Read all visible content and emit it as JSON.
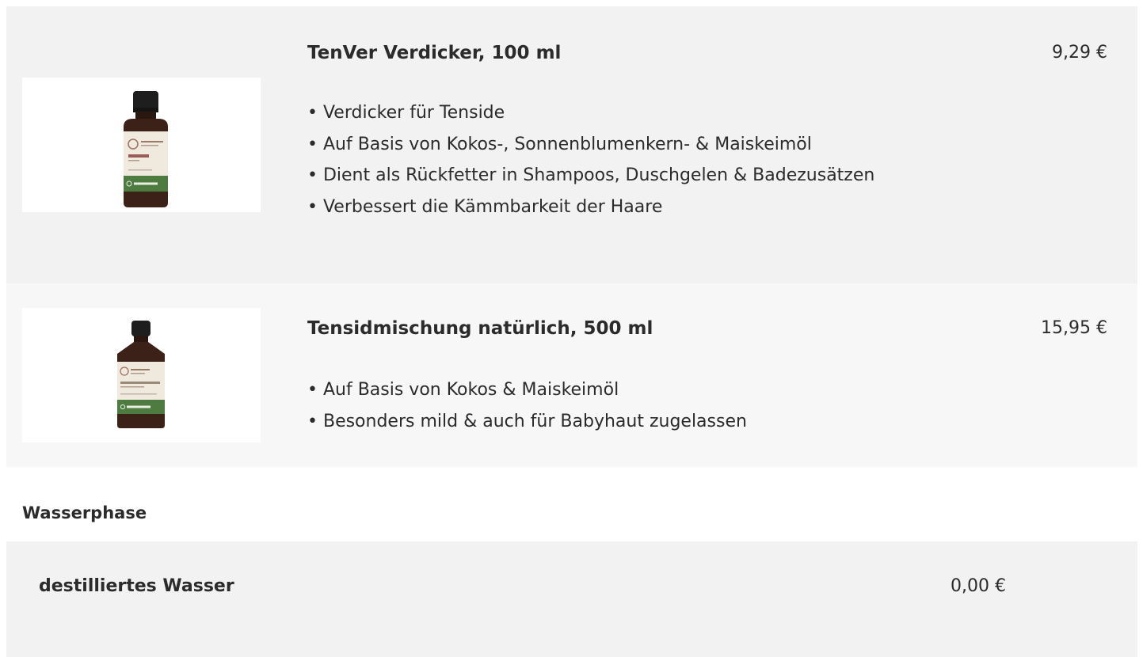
{
  "products": [
    {
      "title": "TenVer Verdicker, 100 ml",
      "price": "9,29 €",
      "image_alt": "TenVer Verdicker Flasche",
      "features": [
        "• Verdicker für Tenside",
        "• Auf Basis von Kokos-, Sonnenblumenkern- & Maiskeimöl",
        "• Dient als Rückfetter in Shampoos, Duschgelen & Badezusätzen",
        "• Verbessert die Kämmbarkeit der Haare"
      ]
    },
    {
      "title": "Tensidmischung natürlich, 500 ml",
      "price": "15,95 €",
      "image_alt": "Tensidmischung natürlich Flasche",
      "features": [
        "• Auf Basis von Kokos & Maiskeimöl",
        "• Besonders mild & auch für Babyhaut zugelassen"
      ]
    }
  ],
  "section": {
    "heading": "Wasserphase"
  },
  "ingredient": {
    "name": "destilliertes Wasser",
    "price": "0,00 €"
  },
  "colors": {
    "card_bg": "#f2f2f2",
    "card_bg_alt": "#f7f7f7",
    "text": "#2b2b2b",
    "bottle_glass": "#3b2118",
    "bottle_cap": "#1e1e1e",
    "label_green": "#4e7b3f",
    "label_cream": "#efe9de"
  }
}
